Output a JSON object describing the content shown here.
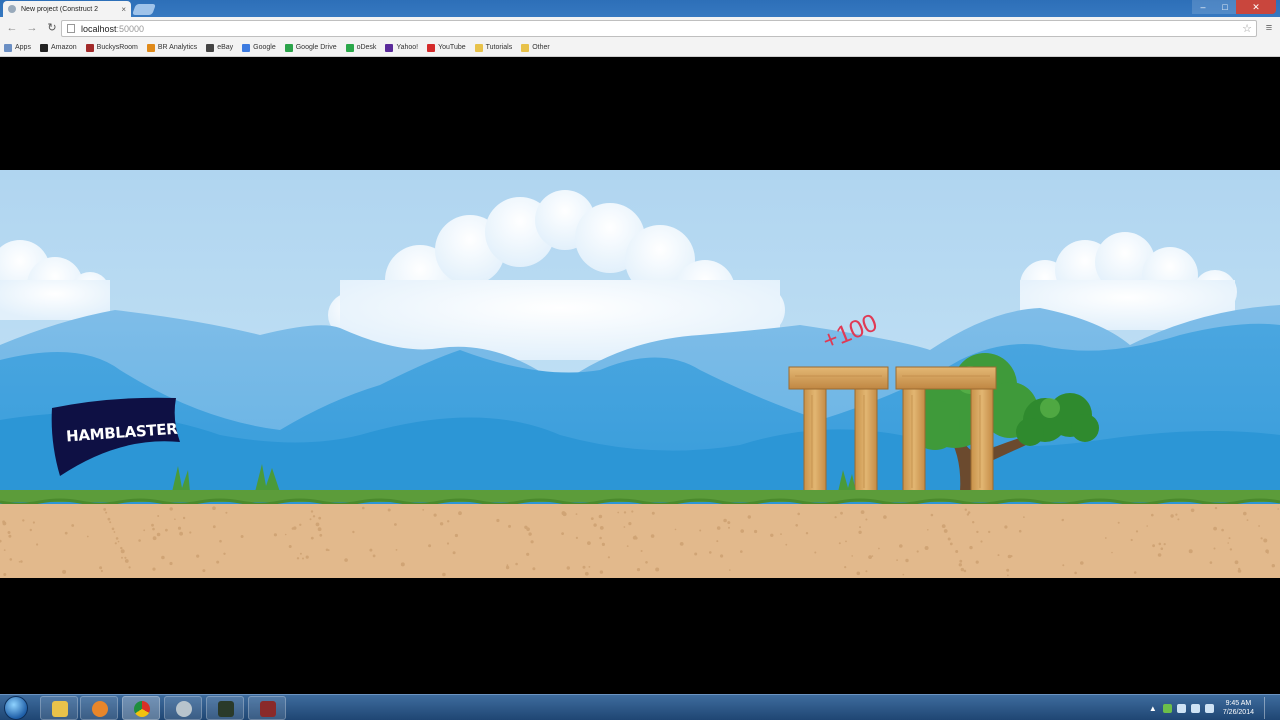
{
  "browser": {
    "tab_title": "New project (Construct 2",
    "tab_close": "×",
    "url_host": "localhost",
    "url_port": ":50000",
    "bookmarks": [
      {
        "label": "Apps",
        "color": "#6b8fc4"
      },
      {
        "label": "Amazon",
        "color": "#222222"
      },
      {
        "label": "BuckysRoom",
        "color": "#a22a2a"
      },
      {
        "label": "BR Analytics",
        "color": "#e08a1a"
      },
      {
        "label": "eBay",
        "color": "#444444"
      },
      {
        "label": "Google",
        "color": "#3d7be0"
      },
      {
        "label": "Google Drive",
        "color": "#2ba34a"
      },
      {
        "label": "oDesk",
        "color": "#2aa84a"
      },
      {
        "label": "Yahoo!",
        "color": "#5a2a9a"
      },
      {
        "label": "YouTube",
        "color": "#d42a2a"
      },
      {
        "label": "Tutorials",
        "color": "#e8c24a"
      },
      {
        "label": "Other",
        "color": "#e8c24a"
      }
    ]
  },
  "game": {
    "banner_text": "HAMBLASTER",
    "score_popup": "+100"
  },
  "taskbar": {
    "time": "9:45 AM",
    "date": "7/26/2014"
  },
  "colors": {
    "sky": "#b4d8f2",
    "mountain_far": "#6fb5e6",
    "mountain_near": "#3aa0dc",
    "grass": "#5c9c3a",
    "dirt": "#e2b98c",
    "wood": "#d9a85f",
    "banner": "#0e1044",
    "score": "#e03a55"
  }
}
